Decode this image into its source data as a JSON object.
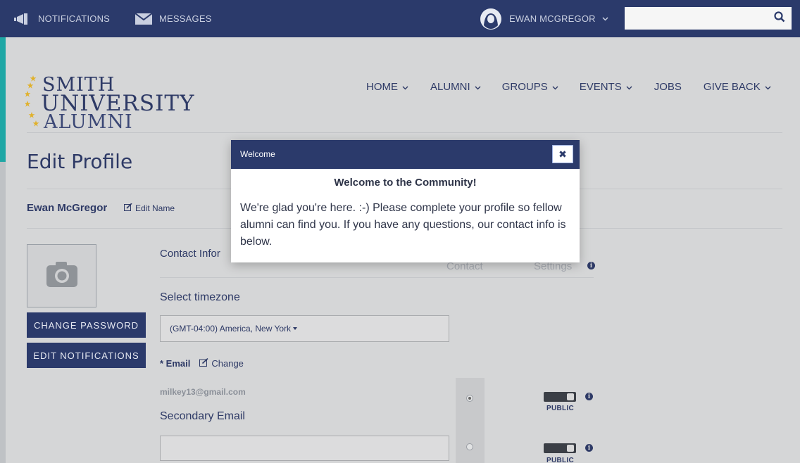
{
  "topbar": {
    "notifications_label": "NOTIFICATIONS",
    "messages_label": "MESSAGES",
    "user_name": "EWAN MCGREGOR",
    "search_placeholder": ""
  },
  "logo": {
    "line1": "SMITH",
    "line2": "UNIVERSITY",
    "line3": "ALUMNI"
  },
  "nav": {
    "items": [
      {
        "label": "HOME",
        "has_dropdown": true
      },
      {
        "label": "ALUMNI",
        "has_dropdown": true
      },
      {
        "label": "GROUPS",
        "has_dropdown": true
      },
      {
        "label": "EVENTS",
        "has_dropdown": true
      },
      {
        "label": "JOBS",
        "has_dropdown": false
      },
      {
        "label": "GIVE BACK",
        "has_dropdown": true
      }
    ]
  },
  "page": {
    "title": "Edit Profile",
    "user_full_name": "Ewan McGregor",
    "edit_name_label": "Edit Name",
    "change_password_label": "CHANGE PASSWORD",
    "edit_notifications_label": "EDIT NOTIFICATIONS",
    "contact_info_label": "Contact Infor",
    "tab_contact": "Contact",
    "tab_settings": "Settings",
    "select_timezone_label": "Select timezone",
    "timezone_value": "(GMT-04:00) America, New York",
    "email_label": "* Email",
    "change_label": "Change",
    "email_value": "milkey13@gmail.com",
    "secondary_email_label": "Secondary Email",
    "secondary_email_value": "",
    "public_label_1": "PUBLIC",
    "public_label_2": "PUBLIC"
  },
  "modal": {
    "title": "Welcome",
    "close_glyph": "✖",
    "heading": "Welcome to the Community!",
    "body": "We're glad you're here. :-) Please complete your profile so fellow alumni can find you.  If you have any questions, our contact info is below."
  },
  "colors": {
    "navy": "#2b3a6b",
    "teal": "#1fa7a5",
    "page_dimmed": "#d5d6d7",
    "gold": "#e0b12c"
  }
}
